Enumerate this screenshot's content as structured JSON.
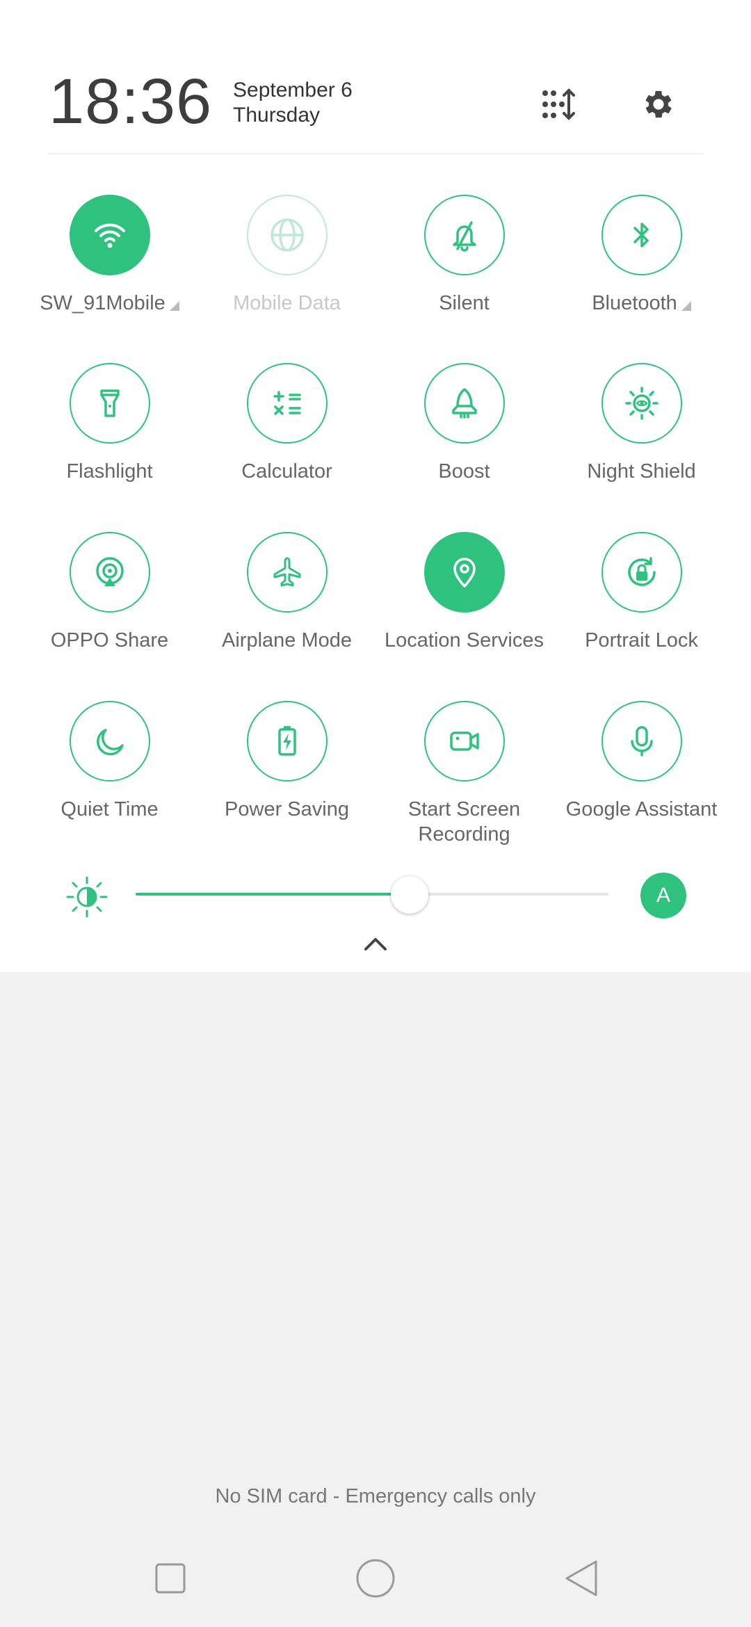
{
  "header": {
    "time": "18:36",
    "date": "September 6",
    "weekday": "Thursday"
  },
  "tiles": [
    {
      "label": "SW_91Mobile",
      "icon": "wifi-icon",
      "state": "on"
    },
    {
      "label": "Mobile Data",
      "icon": "globe-icon",
      "state": "disabled"
    },
    {
      "label": "Silent",
      "icon": "bell-off-icon",
      "state": "off"
    },
    {
      "label": "Bluetooth",
      "icon": "bluetooth-icon",
      "state": "off"
    },
    {
      "label": "Flashlight",
      "icon": "flashlight-icon",
      "state": "off"
    },
    {
      "label": "Calculator",
      "icon": "calculator-icon",
      "state": "off"
    },
    {
      "label": "Boost",
      "icon": "rocket-icon",
      "state": "off"
    },
    {
      "label": "Night Shield",
      "icon": "eye-icon",
      "state": "off"
    },
    {
      "label": "OPPO Share",
      "icon": "share-icon",
      "state": "off"
    },
    {
      "label": "Airplane Mode",
      "icon": "airplane-icon",
      "state": "off"
    },
    {
      "label": "Location Services",
      "icon": "location-pin-icon",
      "state": "on"
    },
    {
      "label": "Portrait Lock",
      "icon": "rotation-lock-icon",
      "state": "off"
    },
    {
      "label": "Quiet Time",
      "icon": "moon-icon",
      "state": "off"
    },
    {
      "label": "Power Saving",
      "icon": "battery-bolt-icon",
      "state": "off"
    },
    {
      "label": "Start Screen\nRecording",
      "label_line1": "Start Screen",
      "label_line2": "Recording",
      "icon": "video-camera-icon",
      "state": "off"
    },
    {
      "label": "Google Assistant",
      "icon": "microphone-icon",
      "state": "off"
    }
  ],
  "brightness": {
    "level": 0.58,
    "auto_label": "A"
  },
  "status": {
    "sim_text": "No SIM card - Emergency calls only"
  },
  "colors": {
    "accent": "#2ec27e",
    "panel": "#ffffff",
    "background": "#f1f1f1"
  }
}
